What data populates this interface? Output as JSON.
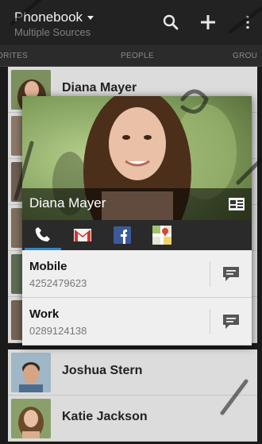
{
  "header": {
    "title": "Phonebook",
    "subtitle": "Multiple Sources",
    "icons": [
      "search-icon",
      "add-icon",
      "overflow-menu-icon"
    ]
  },
  "tabs": [
    {
      "label": "ORITES"
    },
    {
      "label": "PEOPLE"
    },
    {
      "label": "GROU"
    }
  ],
  "list": [
    {
      "name": "Diana Mayer"
    },
    {
      "name": "Joshua Stern"
    },
    {
      "name": "Katie Jackson"
    }
  ],
  "popup": {
    "name": "Diana Mayer",
    "actions": [
      "phone-icon",
      "gmail-icon",
      "facebook-icon",
      "google-maps-icon"
    ],
    "details": [
      {
        "label": "Mobile",
        "value": "4252479623"
      },
      {
        "label": "Work",
        "value": "0289124138"
      }
    ]
  },
  "colors": {
    "accent": "#2f86c8",
    "header_bg": "#222222",
    "list_row_bg": "#dcdcdc"
  }
}
